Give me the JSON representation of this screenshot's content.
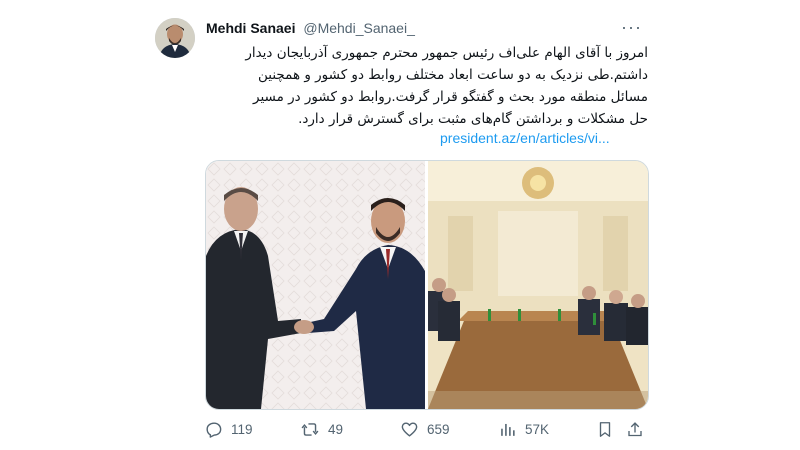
{
  "author": {
    "display_name": "Mehdi Sanaei",
    "handle": "@Mehdi_Sanaei_"
  },
  "tweet": {
    "text_lines": [
      "امروز با آقای الهام علی‌اف رئیس جمهور محترم جمهوری آذربایجان دیدار",
      "داشتم.طی نزدیک به دو ساعت ابعاد مختلف روابط دو کشور و همچنین",
      "مسائل منطقه مورد بحث و گفتگو قرار گرفت.روابط دو کشور در مسیر",
      "حل مشکلات و برداشتن گام‌های مثبت برای گسترش قرار دارد."
    ],
    "link_text": "president.az/en/articles/vi..."
  },
  "actions": {
    "replies": "119",
    "retweets": "49",
    "likes": "659",
    "views": "57K"
  },
  "icons": {
    "reply": "reply-icon",
    "retweet": "retweet-icon",
    "like": "heart-icon",
    "views": "views-icon",
    "bookmark": "bookmark-icon",
    "share": "share-icon",
    "more": "more-icon"
  },
  "colors": {
    "link": "#1d9bf0",
    "secondary_text": "#536471",
    "border": "#cfd9de"
  }
}
